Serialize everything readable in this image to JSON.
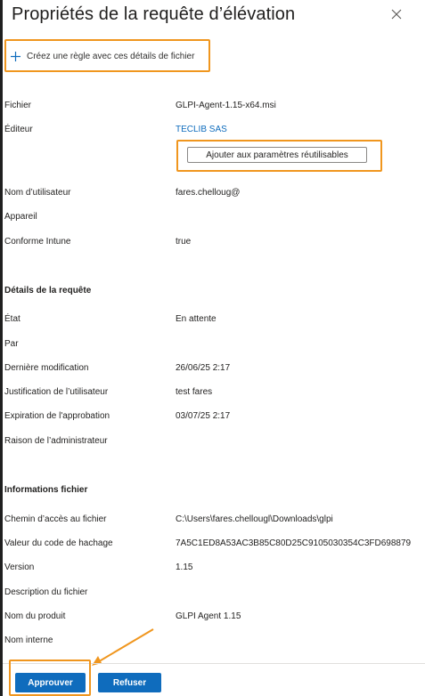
{
  "panel": {
    "title": "Propriétés de la requête d’élévation",
    "close_icon": "close-icon"
  },
  "actions": {
    "create_rule_label": "Créez une règle avec ces détails de fichier",
    "reuse_button_label": "Ajouter aux paramètres réutilisables",
    "approve_label": "Approuver",
    "refuse_label": "Refuser"
  },
  "general": {
    "fichier_label": "Fichier",
    "fichier_value": "GLPI-Agent-1.15-x64.msi",
    "editeur_label": "Éditeur",
    "editeur_value": "TECLIB SAS",
    "utilisateur_label": "Nom d’utilisateur",
    "utilisateur_value": "fares.chelloug@",
    "appareil_label": "Appareil",
    "appareil_value": "",
    "conforme_label": "Conforme Intune",
    "conforme_value": "true"
  },
  "request": {
    "heading": "Détails de la requête",
    "etat_label": "État",
    "etat_value": "En attente",
    "par_label": "Par",
    "par_value": "",
    "modif_label": "Dernière modification",
    "modif_value": "26/06/25 2:17",
    "justif_label": "Justification de l’utilisateur",
    "justif_value": "test fares",
    "expiration_label": "Expiration de l'approbation",
    "expiration_value": "03/07/25 2:17",
    "raison_label": "Raison de l’administrateur",
    "raison_value": ""
  },
  "file_info": {
    "heading": "Informations fichier",
    "chemin_label": "Chemin d’accès au fichier",
    "chemin_value": "C:\\Users\\fares.chellougl\\Downloads\\glpi",
    "hash_label": "Valeur du code de hachage",
    "hash_value": "7A5C1ED8A53AC3B85C80D25C9105030354C3FD698879",
    "version_label": "Version",
    "version_value": "1.15",
    "description_label": "Description du fichier",
    "description_value": "",
    "produit_label": "Nom du produit",
    "produit_value": "GLPI Agent 1.15",
    "interne_label": "Nom interne",
    "interne_value": ""
  },
  "colors": {
    "accent": "#0f6cbd",
    "highlight": "#f0961e"
  }
}
